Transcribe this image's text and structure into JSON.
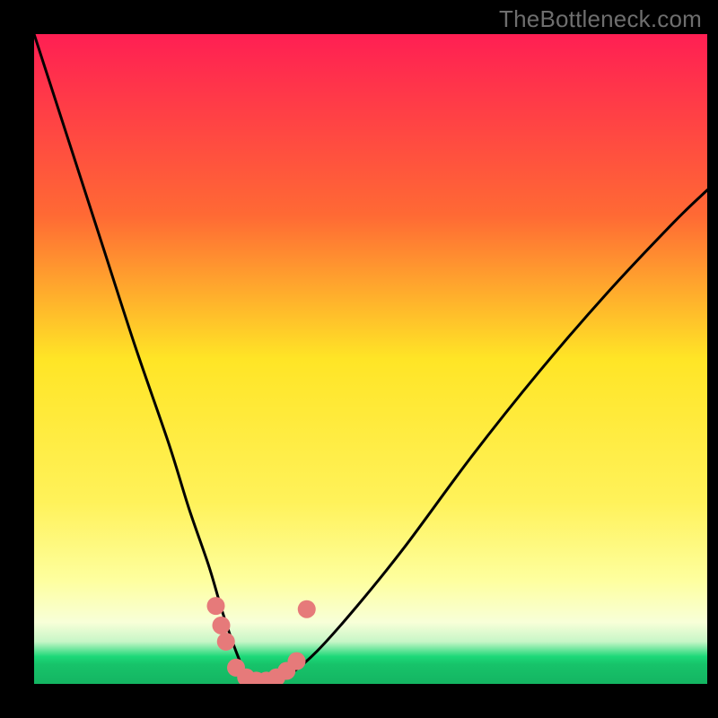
{
  "watermark": "TheBottleneck.com",
  "colors": {
    "frame": "#000000",
    "gradient_top": "#ff1f53",
    "gradient_mid_upper": "#ff8d2a",
    "gradient_mid": "#ffe526",
    "gradient_mid_lower": "#fdfb7f",
    "gradient_lower": "#f4ffcf",
    "gradient_green": "#1cd878",
    "curve": "#000000",
    "dots": "#e67a7a"
  },
  "chart_data": {
    "type": "line",
    "title": "",
    "xlabel": "",
    "ylabel": "",
    "xlim": [
      0,
      100
    ],
    "ylim": [
      0,
      100
    ],
    "series": [
      {
        "name": "bottleneck-curve",
        "x": [
          0,
          5,
          10,
          15,
          20,
          23,
          26,
          28,
          30,
          31.5,
          33,
          35,
          38,
          42,
          48,
          55,
          65,
          75,
          85,
          95,
          100
        ],
        "values": [
          100,
          84,
          68,
          52,
          37,
          27,
          18,
          11,
          5,
          1.5,
          0,
          0,
          1.5,
          5,
          12,
          21,
          35,
          48,
          60,
          71,
          76
        ]
      }
    ],
    "points": [
      {
        "x": 27.0,
        "y": 12.0
      },
      {
        "x": 27.8,
        "y": 9.0
      },
      {
        "x": 28.5,
        "y": 6.5
      },
      {
        "x": 30.0,
        "y": 2.5
      },
      {
        "x": 31.5,
        "y": 1.0
      },
      {
        "x": 33.0,
        "y": 0.5
      },
      {
        "x": 34.5,
        "y": 0.5
      },
      {
        "x": 36.0,
        "y": 1.0
      },
      {
        "x": 37.5,
        "y": 2.0
      },
      {
        "x": 39.0,
        "y": 3.5
      },
      {
        "x": 40.5,
        "y": 11.5
      }
    ],
    "optimal_x": 34,
    "green_band_y": [
      0,
      4
    ]
  }
}
